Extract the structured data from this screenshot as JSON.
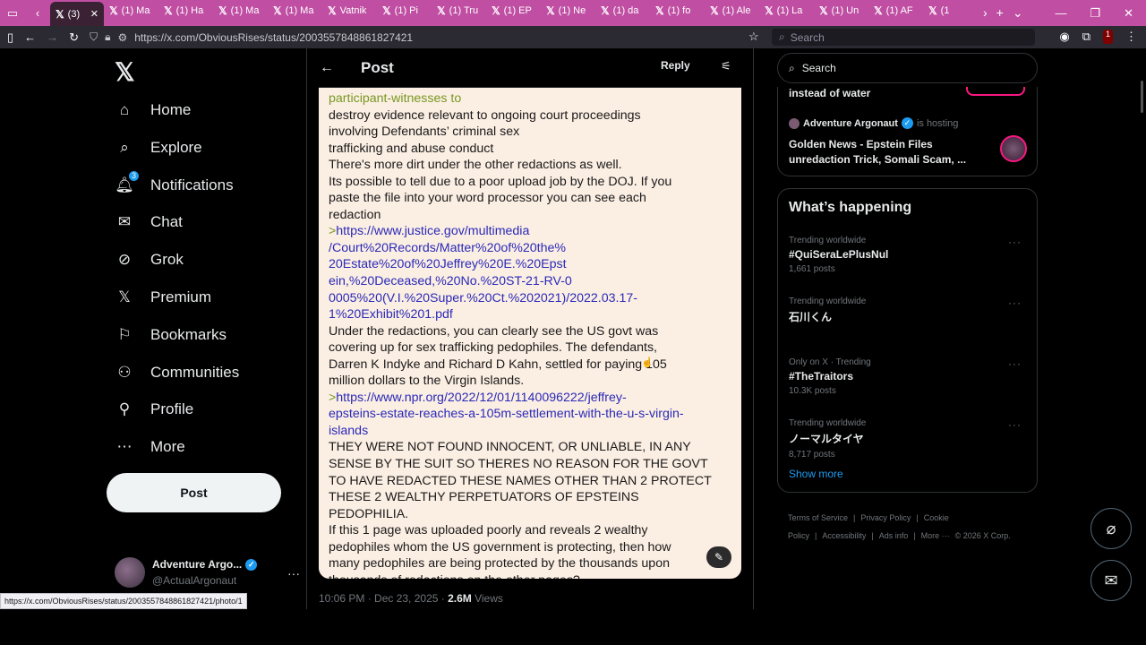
{
  "browser": {
    "tabs": [
      {
        "label": "(3)",
        "active": true
      },
      {
        "label": "(1) Ma"
      },
      {
        "label": "(1) Ha"
      },
      {
        "label": "(1) Ma"
      },
      {
        "label": "(1) Ma"
      },
      {
        "label": "Vatnik"
      },
      {
        "label": "(1) Pi"
      },
      {
        "label": "(1) Tru"
      },
      {
        "label": "(1) EP"
      },
      {
        "label": "(1) Ne"
      },
      {
        "label": "(1) da"
      },
      {
        "label": "(1) fo"
      },
      {
        "label": "(1) Ale"
      },
      {
        "label": "(1) La"
      },
      {
        "label": "(1) Un"
      },
      {
        "label": "(1) AF"
      },
      {
        "label": "(1"
      }
    ],
    "url": "https://x.com/ObviousRises/status/2003557848861827421",
    "search_placeholder": "Search",
    "ublock_count": "1",
    "status_url": "https://x.com/ObviousRises/status/2003557848861827421/photo/1"
  },
  "sidebar": {
    "items": [
      {
        "label": "Home"
      },
      {
        "label": "Explore"
      },
      {
        "label": "Notifications",
        "badge": "3"
      },
      {
        "label": "Chat"
      },
      {
        "label": "Grok"
      },
      {
        "label": "Premium"
      },
      {
        "label": "Bookmarks"
      },
      {
        "label": "Communities"
      },
      {
        "label": "Profile"
      },
      {
        "label": "More"
      }
    ],
    "post_button": "Post",
    "account": {
      "name": "Adventure Argo...",
      "handle": "@ActualArgonaut"
    }
  },
  "main": {
    "title": "Post",
    "reply": "Reply",
    "doc_lines": [
      {
        "text": "participant-witnesses to",
        "style": "green"
      },
      {
        "text": "destroy evidence relevant to ongoing court proceedings",
        "style": "normal"
      },
      {
        "text": "involving Defendants’ criminal sex",
        "style": "normal"
      },
      {
        "text": "trafficking and abuse conduct",
        "style": "normal"
      },
      {
        "text": "There's more dirt under the other redactions as well.",
        "style": "normal"
      },
      {
        "text": "Its possible to tell due to a poor upload job by the DOJ. If you",
        "style": "normal"
      },
      {
        "text": "paste the file into your word processor you can see each",
        "style": "normal"
      },
      {
        "text": "redaction",
        "style": "normal"
      },
      {
        "text": "https://www.justice.gov/multimedia",
        "style": "link",
        "prefix": ">"
      },
      {
        "text": "/Court%20Records/Matter%20of%20the%",
        "style": "link"
      },
      {
        "text": "20Estate%20of%20Jeffrey%20E.%20Epst",
        "style": "link"
      },
      {
        "text": "ein,%20Deceased,%20No.%20ST-21-RV-0",
        "style": "link"
      },
      {
        "text": "0005%20(V.I.%20Super.%20Ct.%202021)/2022.03.17-",
        "style": "link"
      },
      {
        "text": "1%20Exhibit%201.pdf",
        "style": "link"
      },
      {
        "text": "Under the redactions, you can clearly see the US govt was",
        "style": "normal"
      },
      {
        "text": "covering up for sex trafficking pedophiles. The defendants,",
        "style": "normal"
      },
      {
        "text": "Darren K Indyke and Richard D Kahn, settled for paying 105",
        "style": "normal"
      },
      {
        "text": "million dollars to the Virgin Islands.",
        "style": "normal"
      },
      {
        "text": "https://www.npr.org/2022/12/01/1140096222/jeffrey-",
        "style": "link",
        "prefix": ">"
      },
      {
        "text": "epsteins-estate-reaches-a-105m-settlement-with-the-u-s-virgin-",
        "style": "link"
      },
      {
        "text": "islands",
        "style": "link"
      },
      {
        "text": "THEY WERE NOT FOUND INNOCENT, OR UNLIABLE, IN ANY",
        "style": "normal"
      },
      {
        "text": "SENSE BY THE SUIT SO THERES NO REASON FOR THE GOVT",
        "style": "normal"
      },
      {
        "text": "TO HAVE REDACTED THESE NAMES OTHER THAN 2 PROTECT",
        "style": "normal"
      },
      {
        "text": "THESE 2 WEALTHY PERPETUATORS OF EPSTEINS",
        "style": "normal"
      },
      {
        "text": "PEDOPHILIA.",
        "style": "normal"
      },
      {
        "text": "If this 1 page was uploaded poorly and reveals 2 wealthy",
        "style": "normal"
      },
      {
        "text": "pedophiles whom the US government is protecting, then how",
        "style": "normal"
      },
      {
        "text": "many pedophiles are being protected by the thousands upon",
        "style": "normal"
      },
      {
        "text": "thousands of redactions on the other pages?",
        "style": "normal"
      }
    ],
    "timestamp": "10:06 PM · Dec 23, 2025 · ",
    "views_count": "2.6M",
    "views_label": " Views"
  },
  "right": {
    "search_placeholder": "Search",
    "spaces": {
      "prev_title": "instead of water",
      "host_name": "Adventure Argonaut",
      "host_suffix": "is hosting",
      "title_line1": "Golden News - Epstein Files",
      "title_line2": "unredaction Trick, Somali Scam, ..."
    },
    "trends_title": "What’s happening",
    "trends": [
      {
        "meta": "Trending worldwide",
        "name": "#QuiSeraLePlusNul",
        "count": "1,661 posts"
      },
      {
        "meta": "Trending worldwide",
        "name": "石川くん",
        "count": ""
      },
      {
        "meta": "Only on X · Trending",
        "name": "#TheTraitors",
        "count": "10.3K posts"
      },
      {
        "meta": "Trending worldwide",
        "name": "ノーマルタイヤ",
        "count": "8,717 posts"
      }
    ],
    "show_more": "Show more",
    "footer": [
      "Terms of Service",
      "|",
      "Privacy Policy",
      "|",
      "Cookie Policy",
      "|",
      "Accessibility",
      "|",
      "Ads info",
      "|",
      "More ···",
      "© 2026 X Corp."
    ]
  },
  "colors": {
    "accent": "#1d9bf0",
    "tabbar": "#c04fa3",
    "doc_bg": "#fbeee3",
    "link": "#2a2ab8",
    "greentext": "#789922"
  }
}
